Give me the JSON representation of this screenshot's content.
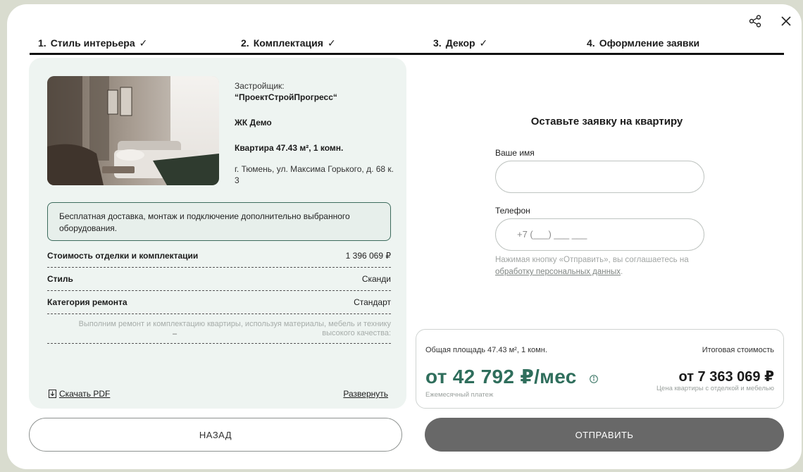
{
  "steps": [
    {
      "num": "1.",
      "label": "Стиль интерьера",
      "done": "✓"
    },
    {
      "num": "2.",
      "label": "Комплектация",
      "done": "✓"
    },
    {
      "num": "3.",
      "label": "Декор",
      "done": "✓"
    },
    {
      "num": "4.",
      "label": "Оформление заявки",
      "done": ""
    }
  ],
  "toolbar": {
    "share_icon": "share-icon",
    "close_icon": "close-icon"
  },
  "apartment": {
    "developer_label": "Застройщик:",
    "developer_name": "“ПроектСтройПрогресс“",
    "complex": "ЖК Демо",
    "flat": "Квартира 47.43 м², 1 комн.",
    "address": "г. Тюмень, ул. Максима Горького, д. 68 к. 3"
  },
  "note": "Бесплатная доставка, монтаж и подключение дополнительно выбранного оборудования.",
  "details": [
    {
      "key": "Стоимость отделки и комплектации",
      "value": "1 396 069 ₽"
    },
    {
      "key": "Стиль",
      "value": "Сканди"
    },
    {
      "key": "Категория ремонта",
      "value": "Стандарт"
    }
  ],
  "description": "Выполним ремонт и комплектацию квартиры, используя материалы, мебель и технику высокого качества:",
  "description_marker": "–",
  "links": {
    "pdf": "Скачать PDF",
    "expand": "Развернуть"
  },
  "form": {
    "title": "Оставьте заявку на квартиру",
    "name_label": "Ваше имя",
    "name_value": "",
    "phone_label": "Телефон",
    "phone_placeholder": "+7 (___) ___ ___",
    "consent_text": "Нажимая кнопку «Отправить», вы соглашаетесь на",
    "consent_link": "обработку персональных данных",
    "consent_end": "."
  },
  "price": {
    "area": "Общая площадь 47.43 м², 1 комн.",
    "total_label": "Итоговая стоимость",
    "monthly": "от 42 792 ₽/мес",
    "monthly_sub": "Ежемесячный платеж",
    "total": "от 7 363 069 ₽",
    "total_sub": "Цена квартиры с отделкой и мебелью"
  },
  "buttons": {
    "back": "НАЗАД",
    "send": "ОТПРАВИТЬ"
  },
  "colors": {
    "accent": "#2f6e5c",
    "panel": "#eef4f1",
    "send_button": "#686868"
  }
}
